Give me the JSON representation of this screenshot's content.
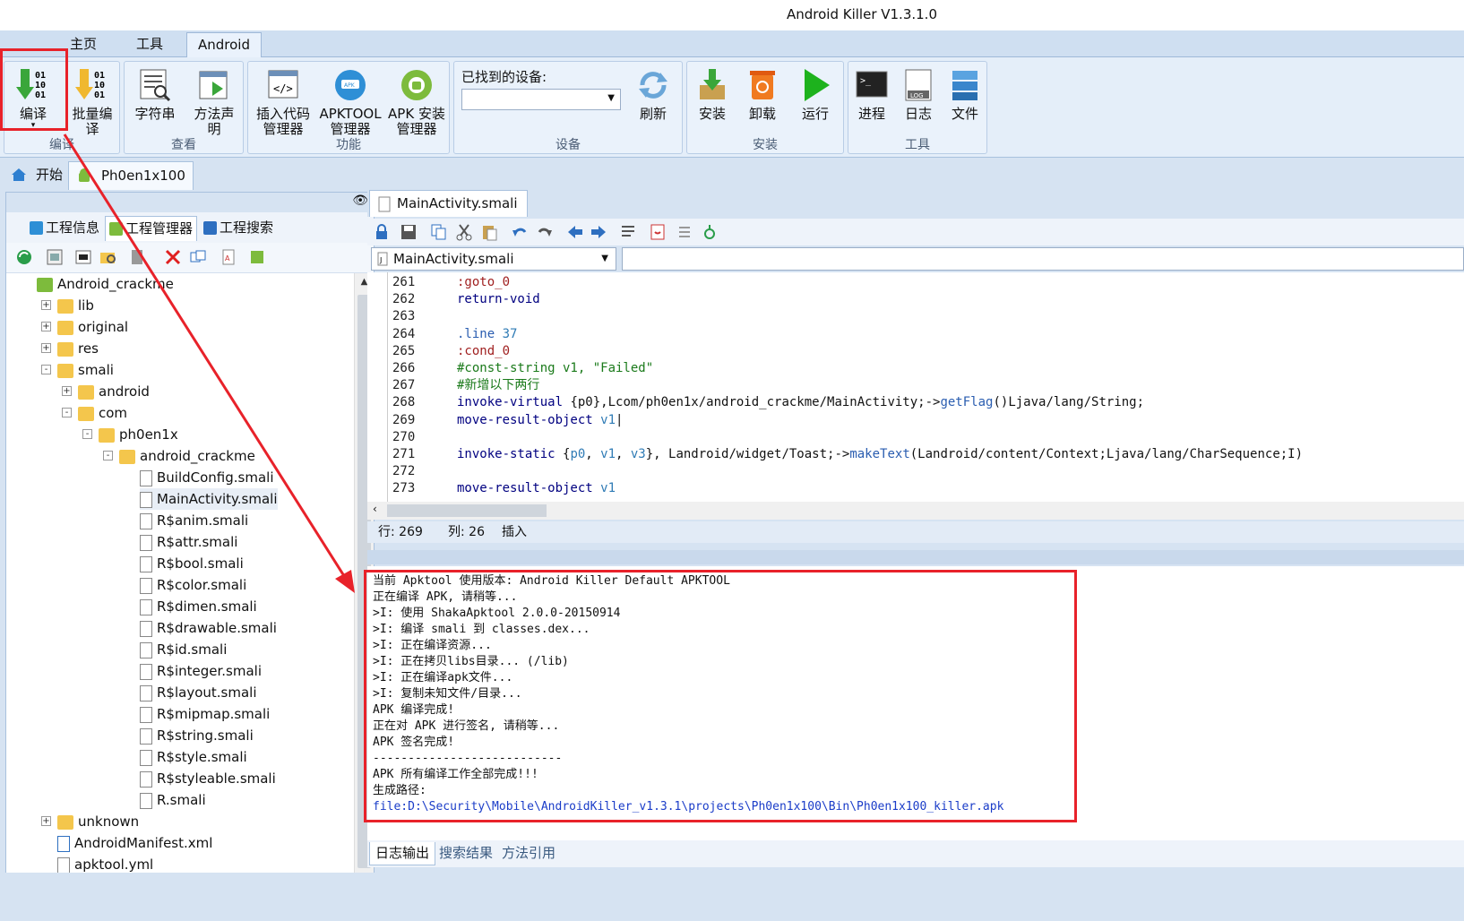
{
  "window": {
    "title": "Android Killer V1.3.1.0"
  },
  "menu": {
    "tabs": [
      "主页",
      "工具",
      "Android"
    ],
    "active": "Android"
  },
  "ribbon": {
    "compile_group": {
      "label": "编译",
      "buttons": [
        "编译",
        "批量编\n译"
      ]
    },
    "view_group": {
      "label": "查看",
      "buttons": [
        "字符串",
        "方法声\n明"
      ]
    },
    "func_group": {
      "label": "功能",
      "buttons": [
        "插入代码\n管理器",
        "APKTOOL\n管理器",
        "APK 安装\n管理器"
      ]
    },
    "device_group": {
      "label": "设备",
      "found_label": "已找到的设备:",
      "refresh": "刷新"
    },
    "install_group": {
      "label": "安装",
      "buttons": [
        "安装",
        "卸载",
        "运行"
      ]
    },
    "tools_group": {
      "label": "工具",
      "buttons": [
        "进程",
        "日志",
        "文件"
      ]
    }
  },
  "doc_tabs": {
    "start": "开始",
    "project": "Ph0en1x100"
  },
  "left_panel": {
    "tabs": [
      "工程信息",
      "工程管理器",
      "工程搜索"
    ],
    "tree": [
      {
        "label": "Android_crackme",
        "depth": 0,
        "type": "root"
      },
      {
        "label": "lib",
        "depth": 1,
        "type": "folder",
        "pm": "+"
      },
      {
        "label": "original",
        "depth": 1,
        "type": "folder",
        "pm": "+"
      },
      {
        "label": "res",
        "depth": 1,
        "type": "folder",
        "pm": "+"
      },
      {
        "label": "smali",
        "depth": 1,
        "type": "folder",
        "pm": "-"
      },
      {
        "label": "android",
        "depth": 2,
        "type": "folder",
        "pm": "+"
      },
      {
        "label": "com",
        "depth": 2,
        "type": "folder",
        "pm": "-"
      },
      {
        "label": "ph0en1x",
        "depth": 3,
        "type": "folder",
        "pm": "-"
      },
      {
        "label": "android_crackme",
        "depth": 4,
        "type": "folder",
        "pm": "-"
      },
      {
        "label": "BuildConfig.smali",
        "depth": 5,
        "type": "file"
      },
      {
        "label": "MainActivity.smali",
        "depth": 5,
        "type": "file",
        "selected": true
      },
      {
        "label": "R$anim.smali",
        "depth": 5,
        "type": "file"
      },
      {
        "label": "R$attr.smali",
        "depth": 5,
        "type": "file"
      },
      {
        "label": "R$bool.smali",
        "depth": 5,
        "type": "file"
      },
      {
        "label": "R$color.smali",
        "depth": 5,
        "type": "file"
      },
      {
        "label": "R$dimen.smali",
        "depth": 5,
        "type": "file"
      },
      {
        "label": "R$drawable.smali",
        "depth": 5,
        "type": "file"
      },
      {
        "label": "R$id.smali",
        "depth": 5,
        "type": "file"
      },
      {
        "label": "R$integer.smali",
        "depth": 5,
        "type": "file"
      },
      {
        "label": "R$layout.smali",
        "depth": 5,
        "type": "file"
      },
      {
        "label": "R$mipmap.smali",
        "depth": 5,
        "type": "file"
      },
      {
        "label": "R$string.smali",
        "depth": 5,
        "type": "file"
      },
      {
        "label": "R$style.smali",
        "depth": 5,
        "type": "file"
      },
      {
        "label": "R$styleable.smali",
        "depth": 5,
        "type": "file"
      },
      {
        "label": "R.smali",
        "depth": 5,
        "type": "file"
      },
      {
        "label": "unknown",
        "depth": 1,
        "type": "folder",
        "pm": "+"
      },
      {
        "label": "AndroidManifest.xml",
        "depth": 1,
        "type": "xml"
      },
      {
        "label": "apktool.yml",
        "depth": 1,
        "type": "file"
      }
    ]
  },
  "editor": {
    "tab": "MainActivity.smali",
    "file_select": "MainActivity.smali",
    "lines": [
      {
        "n": "261",
        "html": "<span class='lb'>:goto_0</span>"
      },
      {
        "n": "262",
        "html": "<span class='kw'>return-void</span>"
      },
      {
        "n": "263",
        "html": ""
      },
      {
        "n": "264",
        "html": "<span class='mt'>.line</span> <span class='num'>37</span>"
      },
      {
        "n": "265",
        "html": "<span class='lb'>:cond_0</span>"
      },
      {
        "n": "266",
        "html": "<span class='cm'>#const-string v1, \"Failed\"</span>"
      },
      {
        "n": "267",
        "html": "<span class='cm'>#新增以下两行</span>"
      },
      {
        "n": "268",
        "html": "<span class='kw'>invoke-virtual</span> {p0},Lcom/ph0en1x/android_crackme/MainActivity;-><span class='mt'>getFlag</span>()Ljava/lang/String;"
      },
      {
        "n": "269",
        "html": "<span class='kw'>move-result-object</span> <span class='num'>v1</span>|"
      },
      {
        "n": "270",
        "html": ""
      },
      {
        "n": "271",
        "html": "<span class='kw'>invoke-static</span> {<span class='num'>p0</span>, <span class='num'>v1</span>, <span class='num'>v3</span>}, Landroid/widget/Toast;-><span class='mt'>makeText</span>(Landroid/content/Context;Ljava/lang/CharSequence;I)"
      },
      {
        "n": "272",
        "html": ""
      },
      {
        "n": "273",
        "html": "<span class='kw'>move-result-object</span> <span class='num'>v1</span>"
      }
    ],
    "status": {
      "row": "行: 269",
      "col": "列: 26",
      "mode": "插入"
    }
  },
  "log": {
    "lines": [
      "当前 Apktool 使用版本: Android Killer Default APKTOOL",
      "正在编译 APK, 请稍等...",
      ">I: 使用 ShakaApktool 2.0.0-20150914",
      ">I: 编译 smali 到 classes.dex...",
      ">I: 正在编译资源...",
      ">I: 正在拷贝libs目录... (/lib)",
      ">I: 正在编译apk文件...",
      ">I: 复制未知文件/目录...",
      "APK 编译完成!",
      "正在对 APK 进行签名, 请稍等...",
      "APK 签名完成!",
      "---------------------------",
      "APK 所有编译工作全部完成!!!",
      "生成路径:"
    ],
    "link": "file:D:\\Security\\Mobile\\AndroidKiller_v1.3.1\\projects\\Ph0en1x100\\Bin\\Ph0en1x100_killer.apk",
    "tabs": [
      "日志输出",
      "搜索结果",
      "方法引用"
    ]
  },
  "colors": {
    "annotation_red": "#e8222a",
    "ribbon_bg": "#e4eef9",
    "link_blue": "#1a3cc8"
  }
}
